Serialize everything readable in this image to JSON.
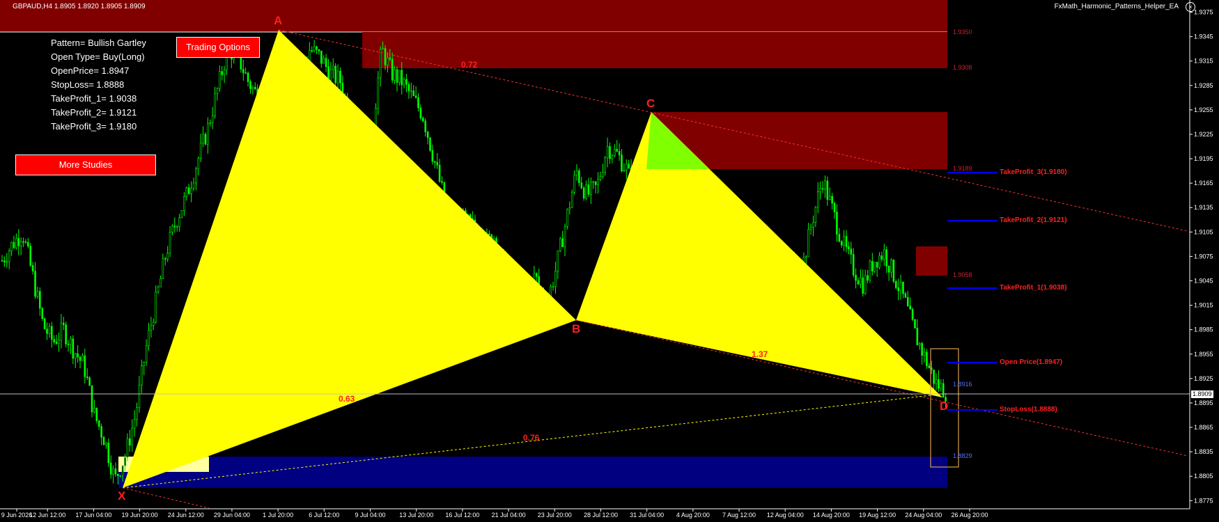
{
  "header": {
    "symbol_quote": "GBPAUD,H4  1.8905 1.8920 1.8905 1.8909",
    "ea_name": "FxMath_Harmonic_Patterns_Helper_EA",
    "close_icon": "close-circle-icon"
  },
  "info": {
    "pattern": "Pattern= Bullish Gartley",
    "open_type": "Open Type= Buy(Long)",
    "open_price": "OpenPrice= 1.8947",
    "stop_loss": "StopLoss= 1.8888",
    "tp1": "TakeProfit_1= 1.9038",
    "tp2": "TakeProfit_2= 1.9121",
    "tp3": "TakeProfit_3= 1.9180"
  },
  "buttons": {
    "trading_options": "Trading Options",
    "more_studies": "More Studies"
  },
  "colors": {
    "background": "#000000",
    "candle": "#00ff00",
    "pattern_fill": "#ffff00",
    "pattern_accent": "#80ff00",
    "resistance_zone": "#800000",
    "support_zone": "#000080",
    "level_line": "#0000ff",
    "label_red": "#ff2020"
  },
  "price_axis": [
    "1.9375",
    "1.9345",
    "1.9315",
    "1.9285",
    "1.9255",
    "1.9225",
    "1.9195",
    "1.9165",
    "1.9135",
    "1.9105",
    "1.9075",
    "1.9045",
    "1.9015",
    "1.8985",
    "1.8955",
    "1.8925",
    "1.8895",
    "1.8865",
    "1.8835",
    "1.8805",
    "1.8775"
  ],
  "current_price": "1.8909",
  "time_axis": [
    "9 Jun 2026",
    "12 Jun 12:00",
    "17 Jun 04:00",
    "19 Jun 20:00",
    "24 Jun 12:00",
    "29 Jun 04:00",
    "1 Jul 20:00",
    "6 Jul 12:00",
    "9 Jul 04:00",
    "13 Jul 20:00",
    "16 Jul 12:00",
    "21 Jul 04:00",
    "23 Jul 20:00",
    "28 Jul 12:00",
    "31 Jul 04:00",
    "4 Aug 20:00",
    "7 Aug 12:00",
    "12 Aug 04:00",
    "14 Aug 20:00",
    "19 Aug 12:00",
    "24 Aug 04:00",
    "26 Aug 20:00"
  ],
  "points": {
    "X": "X",
    "A": "A",
    "B": "B",
    "C": "C",
    "D": "D"
  },
  "ratios": {
    "xb": "0.63",
    "ac": "0.72",
    "bd": "1.37",
    "xd": "0.76"
  },
  "levels": {
    "tp3": "TakeProfit_3(1.9180)",
    "tp2": "TakeProfit_2(1.9121)",
    "tp1": "TakeProfit_1(1.9038)",
    "open": "Open Price(1.8947)",
    "sl": "StopLoss(1.8888)"
  },
  "zone_labels": {
    "z1": "1.9350",
    "z2": "1.9308",
    "z3": "1.9189",
    "z4": "1.9058",
    "z5": "1.8916",
    "z6": "1.8829"
  },
  "chart_data": {
    "type": "candlestick",
    "symbol": "GBPAUD",
    "timeframe": "H4",
    "ylim": [
      1.8765,
      1.939
    ],
    "x": [
      "9 Jun 2026",
      "12 Jun 12:00",
      "17 Jun 04:00",
      "19 Jun 20:00",
      "24 Jun 12:00",
      "29 Jun 04:00",
      "1 Jul 20:00",
      "6 Jul 12:00",
      "9 Jul 04:00",
      "13 Jul 20:00",
      "16 Jul 12:00",
      "21 Jul 04:00",
      "23 Jul 20:00",
      "28 Jul 12:00",
      "31 Jul 04:00",
      "4 Aug 20:00",
      "7 Aug 12:00",
      "12 Aug 04:00",
      "14 Aug 20:00",
      "19 Aug 12:00",
      "24 Aug 04:00",
      "26 Aug 20:00"
    ],
    "close_path": [
      1.907,
      1.909,
      1.9105,
      1.905,
      1.899,
      1.897,
      1.8985,
      1.896,
      1.894,
      1.888,
      1.885,
      1.88,
      1.883,
      1.888,
      1.896,
      1.902,
      1.908,
      1.912,
      1.915,
      1.919,
      1.923,
      1.928,
      1.933,
      1.932,
      1.929,
      1.927,
      1.929,
      1.93,
      1.931,
      1.929,
      1.933,
      1.932,
      1.93,
      1.929,
      1.924,
      1.919,
      1.922,
      1.933,
      1.93,
      1.929,
      1.927,
      1.925,
      1.92,
      1.915,
      1.91,
      1.912,
      1.911,
      1.909,
      1.91,
      1.906,
      1.902,
      1.904,
      1.905,
      1.901,
      1.906,
      1.912,
      1.918,
      1.915,
      1.916,
      1.921,
      1.92,
      1.918,
      1.912,
      1.908,
      1.909,
      1.911,
      1.908,
      1.909,
      1.914,
      1.911,
      1.909,
      1.912,
      1.91,
      1.911,
      1.91,
      1.908,
      1.904,
      1.907,
      1.906,
      1.912,
      1.917,
      1.913,
      1.909,
      1.906,
      1.904,
      1.907,
      1.908,
      1.905,
      1.902,
      1.898,
      1.895,
      1.892,
      1.8909
    ],
    "pattern": {
      "name": "Bullish Gartley",
      "X": 1.879,
      "A": 1.9355,
      "B": 1.9005,
      "C": 1.9255,
      "D": 1.8902
    },
    "ratios": {
      "XB": 0.63,
      "AC": 0.72,
      "BD": 1.37,
      "XD": 0.76
    },
    "levels": {
      "take_profit_3": 1.918,
      "take_profit_2": 1.9121,
      "take_profit_1": 1.9038,
      "open_price": 1.8947,
      "stop_loss": 1.8888
    },
    "zones": [
      {
        "kind": "resistance",
        "from": 1.931,
        "to": 1.9375
      },
      {
        "kind": "resistance",
        "from": 1.9187,
        "to": 1.9255
      },
      {
        "kind": "resistance",
        "from": 1.9055,
        "to": 1.909
      },
      {
        "kind": "support",
        "from": 1.8795,
        "to": 1.883
      }
    ]
  }
}
